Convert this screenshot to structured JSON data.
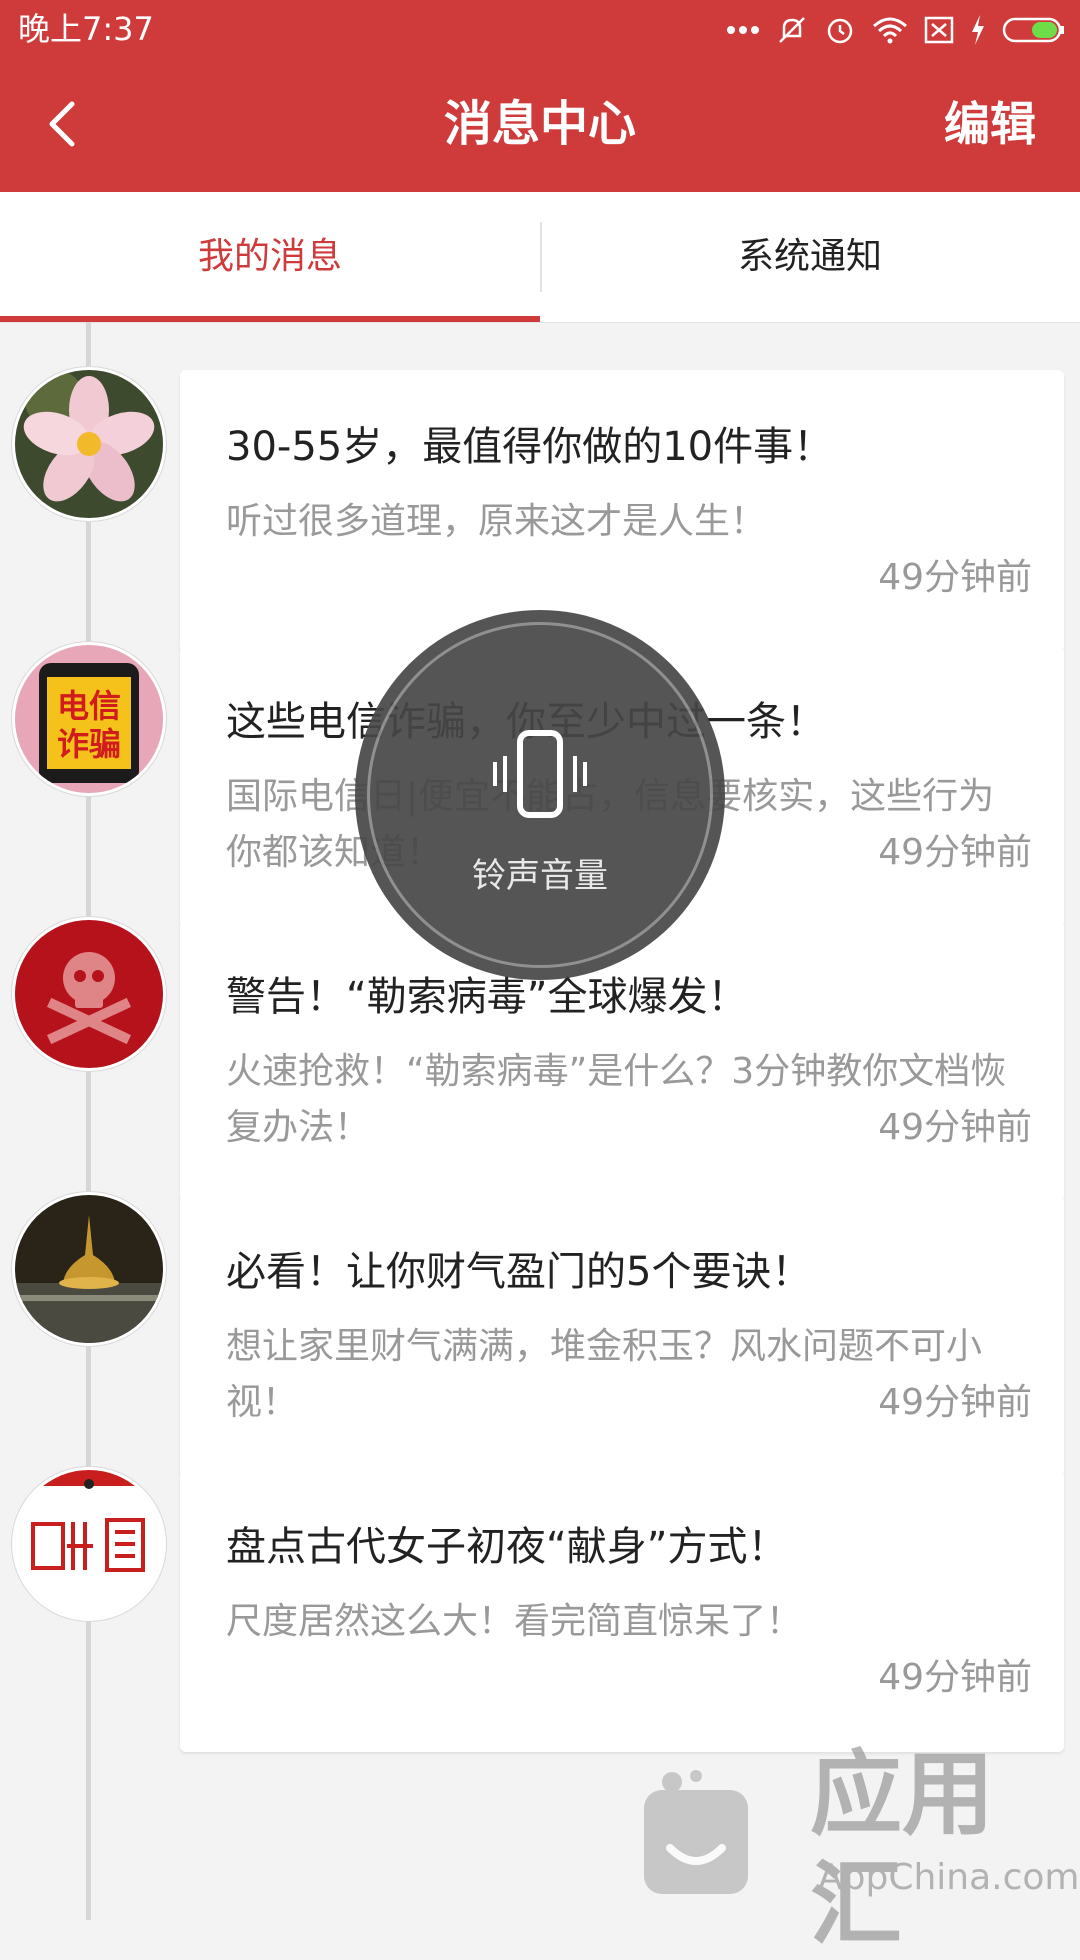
{
  "status_bar": {
    "time": "晚上7:37"
  },
  "header": {
    "title": "消息中心",
    "edit_label": "编辑"
  },
  "tabs": [
    {
      "label": "我的消息",
      "active": true
    },
    {
      "label": "系统通知",
      "active": false
    }
  ],
  "messages": [
    {
      "title": "30-55岁，最值得你做的10件事！",
      "summary": "听过很多道理，原来这才是人生！",
      "time": "49分钟前"
    },
    {
      "title": "这些电信诈骗，你至少中过一条！",
      "summary": "国际电信日|便宜不能占，信息要核实，这些行为你都该知道！",
      "time": "49分钟前",
      "avatar_text": "电信\n诈骗"
    },
    {
      "title": "警告！“勒索病毒”全球爆发！",
      "summary": "火速抢救！“勒索病毒”是什么？3分钟教你文档恢复办法！",
      "time": "49分钟前"
    },
    {
      "title": "必看！让你财气盈门的5个要诀！",
      "summary": "想让家里财气满满，堆金积玉？风水问题不可小视！",
      "time": "49分钟前"
    },
    {
      "title": "盘点古代女子初夜“献身”方式！",
      "summary": "尺度居然这么大！看完简直惊呆了！",
      "time": "49分钟前"
    }
  ],
  "volume_overlay": {
    "label": "铃声音量",
    "icon": "vibrate-icon"
  },
  "watermark": {
    "text": "应用汇",
    "sub": "AppChina.com"
  },
  "colors": {
    "primary": "#cf3b3b",
    "muted_text": "#999999"
  }
}
